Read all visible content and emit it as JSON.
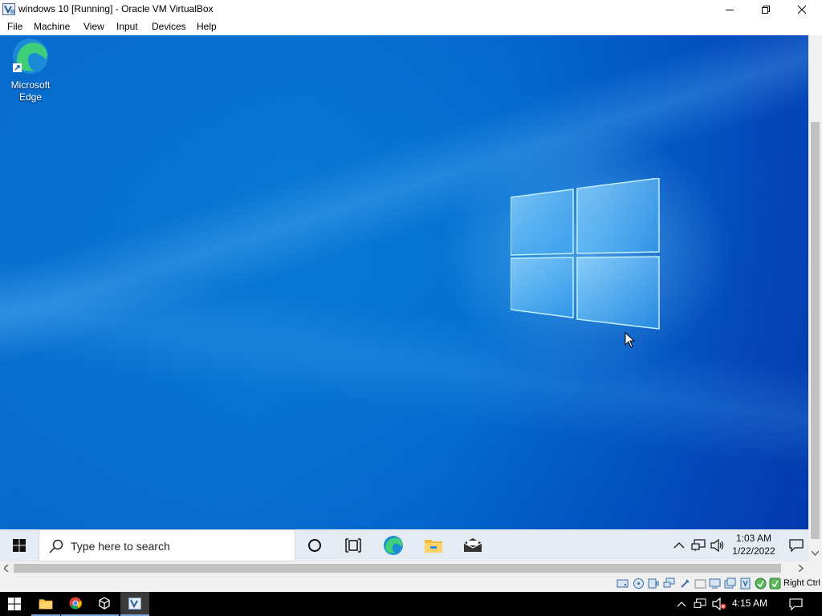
{
  "window": {
    "title": "windows 10 [Running] - Oracle VM VirtualBox",
    "controls": [
      "minimize-icon",
      "restore-icon",
      "close-icon"
    ]
  },
  "menu": {
    "items": [
      "File",
      "Machine",
      "View",
      "Input",
      "Devices",
      "Help"
    ]
  },
  "desktop": {
    "icons": [
      {
        "label_line1": "Microsoft",
        "label_line2": "Edge",
        "icon": "edge-icon"
      }
    ]
  },
  "guest_taskbar": {
    "search_placeholder": "Type here to search",
    "pinned": [
      "cortana-icon",
      "task-view-icon",
      "edge-icon",
      "file-explorer-icon",
      "mail-icon"
    ],
    "tray": [
      "chevron-up-icon",
      "network-icon",
      "volume-icon"
    ],
    "time": "1:03 AM",
    "date": "1/22/2022"
  },
  "statusbar": {
    "icons": [
      "hard-disk-icon",
      "optical-drive-icon",
      "audio-icon",
      "network-icon",
      "usb-icon",
      "shared-folder-icon",
      "display-icon",
      "recording-icon",
      "cpu-icon",
      "mouse-integration-icon",
      "keyboard-icon"
    ],
    "host_key": "Right Ctrl"
  },
  "host_taskbar": {
    "apps": [
      "windows-start-icon",
      "file-explorer-icon",
      "chrome-icon",
      "virtualbox-icon",
      "virtualbox-vm-icon"
    ],
    "time": "4:15 AM"
  },
  "colors": {
    "desktop_blue": "#0a86dc",
    "guest_taskbar": "#e4ebf2",
    "host_taskbar": "#000000"
  }
}
